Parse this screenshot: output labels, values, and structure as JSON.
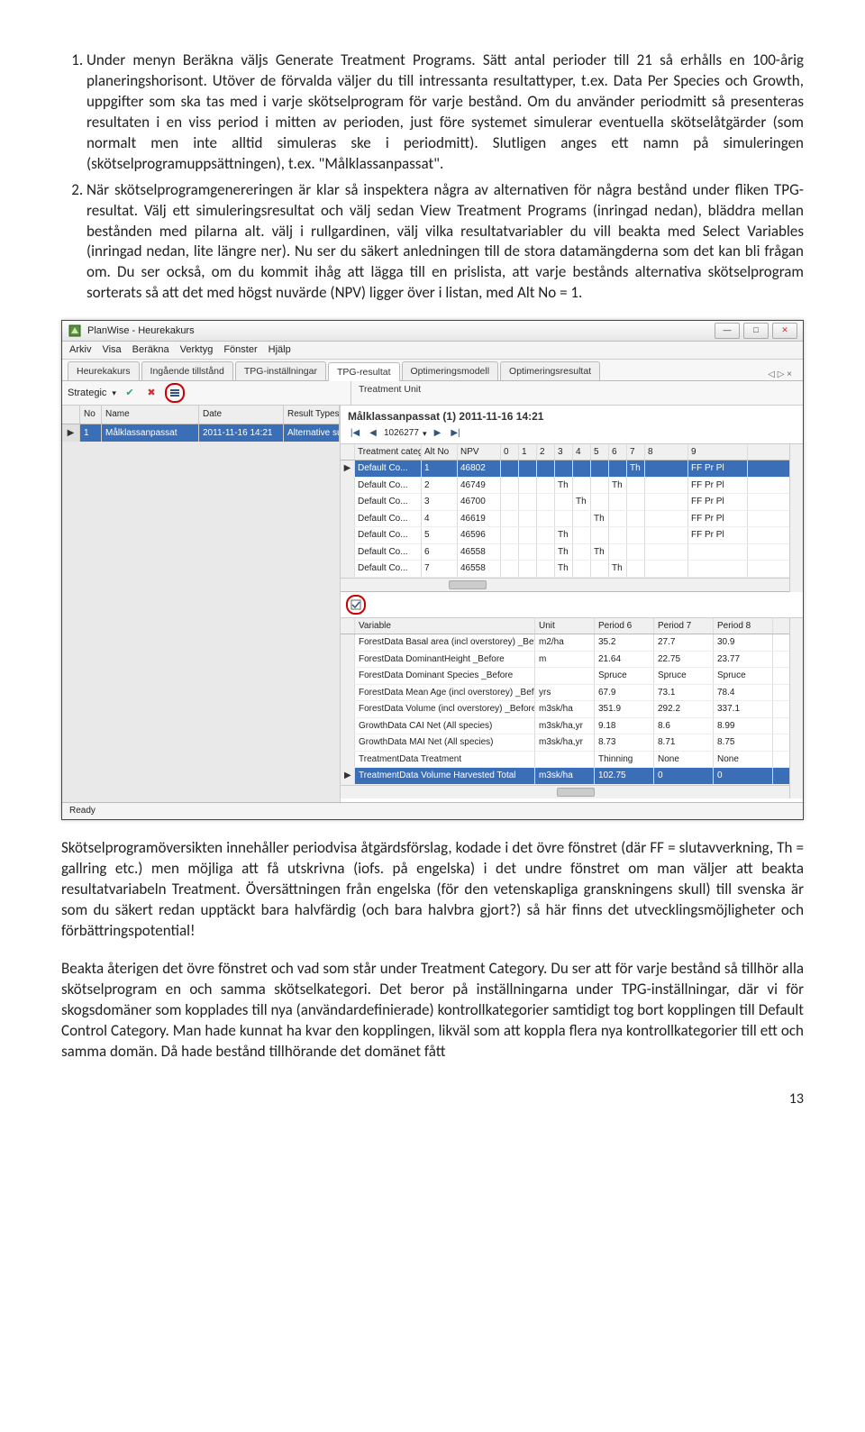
{
  "list": {
    "item1": "Under menyn Beräkna väljs Generate Treatment Programs. Sätt antal perioder till 21 så erhålls en 100-årig planeringshorisont. Utöver de förvalda väljer du till intressanta resultattyper, t.ex. Data Per Species och Growth, uppgifter som ska tas med i varje skötselprogram för varje bestånd. Om du använder periodmitt så presenteras resultaten i en viss period i mitten av perioden, just före systemet simulerar eventuella skötselåtgärder (som normalt men inte alltid simuleras ske i periodmitt). Slutligen anges ett namn på simuleringen (skötselprogramuppsättningen), t.ex. \"Målklassanpassat\".",
    "item2": "När skötselprogramgenereringen är klar så inspektera några av alternativen för några bestånd under fliken TPG-resultat. Välj ett simuleringsresultat och välj sedan View Treatment Programs (inringad nedan), bläddra mellan bestånden med pilarna alt. välj i rullgardinen, välj vilka resultatvariabler du vill beakta med Select Variables (inringad nedan, lite längre ner). Nu ser du säkert anledningen till de stora datamängderna som det kan bli frågan om. Du ser också, om du kommit ihåg att lägga till en prislista, att varje bestånds alternativa skötselprogram sorterats så att det med högst nuvärde (NPV) ligger över i listan, med Alt No = 1."
  },
  "para1": "Skötselprogramöversikten innehåller periodvisa åtgärdsförslag, kodade i det övre fönstret (där FF = slutavverkning, Th = gallring etc.) men möjliga att få utskrivna (iofs. på engelska) i det undre fönstret om man väljer att beakta resultatvariabeln Treatment. Översättningen från engelska (för den vetenskapliga granskningens skull) till svenska är som du säkert redan upptäckt bara halvfärdig (och bara halvbra gjort?) så här finns det utvecklingsmöjligheter och förbättringspotential!",
  "para2": "Beakta återigen det övre fönstret och vad som står under Treatment Category. Du ser att för varje bestånd så tillhör alla skötselprogram en och samma skötselkategori. Det beror på inställningarna under TPG-inställningar, där vi för skogsdomäner som kopplades till nya (användardefinierade) kontrollkategorier samtidigt tog bort kopplingen till Default Control Category. Man hade kunnat ha kvar den kopplingen, likväl som att koppla flera nya kontrollkategorier till ett och samma domän. Då hade bestånd tillhörande det domänet fått",
  "page_number": "13",
  "app": {
    "title": "PlanWise - Heurekakurs",
    "menus": [
      "Arkiv",
      "Visa",
      "Beräkna",
      "Verktyg",
      "Fönster",
      "Hjälp"
    ],
    "tabs": [
      "Heurekakurs",
      "Ingående tillstånd",
      "TPG-inställningar",
      "TPG-resultat",
      "Optimeringsmodell",
      "Optimeringsresultat"
    ],
    "tab_right_nav": "◁ ▷ ×",
    "toolbar_left_label": "Strategic",
    "treatment_unit_label": "Treatment Unit",
    "runs_header": [
      "",
      "No",
      "Name",
      "Date",
      "Result Types"
    ],
    "runs_row": [
      "▶",
      "1",
      "Målklassanpassat",
      "2011-11-16 14:21",
      "Alternative su..."
    ],
    "run_title": "Målklassanpassat (1) 2011-11-16 14:21",
    "record_nav": {
      "first": "|◀",
      "prev": "◀",
      "id": "1026277",
      "next": "▶",
      "last": "▶|",
      "dropdown": "▾"
    },
    "topgrid": {
      "header": [
        "",
        "Treatment category",
        "Alt No",
        "NPV",
        "0",
        "1",
        "2",
        "3",
        "4",
        "5",
        "6",
        "7",
        "8",
        "9"
      ],
      "rows": [
        [
          "▶",
          "Default Co...",
          "1",
          "46802",
          "",
          "",
          "",
          "",
          "",
          "",
          "",
          "Th",
          "",
          "FF Pr Pl"
        ],
        [
          "",
          "Default Co...",
          "2",
          "46749",
          "",
          "",
          "",
          "Th",
          "",
          "",
          "Th",
          "",
          "",
          "FF Pr Pl"
        ],
        [
          "",
          "Default Co...",
          "3",
          "46700",
          "",
          "",
          "",
          "",
          "Th",
          "",
          "",
          "",
          "",
          "FF Pr Pl"
        ],
        [
          "",
          "Default Co...",
          "4",
          "46619",
          "",
          "",
          "",
          "",
          "",
          "Th",
          "",
          "",
          "",
          "FF Pr Pl"
        ],
        [
          "",
          "Default Co...",
          "5",
          "46596",
          "",
          "",
          "",
          "Th",
          "",
          "",
          "",
          "",
          "",
          "FF Pr Pl"
        ],
        [
          "",
          "Default Co...",
          "6",
          "46558",
          "",
          "",
          "",
          "Th",
          "",
          "Th",
          "",
          "",
          "",
          ""
        ],
        [
          "",
          "Default Co...",
          "7",
          "46558",
          "",
          "",
          "",
          "Th",
          "",
          "",
          "Th",
          "",
          "",
          ""
        ]
      ]
    },
    "botgrid": {
      "header": [
        "",
        "Variable",
        "Unit",
        "Period 6",
        "Period 7",
        "Period 8"
      ],
      "rows": [
        [
          "",
          "ForestData Basal area (incl overstorey) _Before",
          "m2/ha",
          "35.2",
          "27.7",
          "30.9"
        ],
        [
          "",
          "ForestData DominantHeight _Before",
          "m",
          "21.64",
          "22.75",
          "23.77"
        ],
        [
          "",
          "ForestData Dominant Species _Before",
          "",
          "Spruce",
          "Spruce",
          "Spruce"
        ],
        [
          "",
          "ForestData Mean Age (incl overstorey) _Before",
          "yrs",
          "67.9",
          "73.1",
          "78.4"
        ],
        [
          "",
          "ForestData Volume (incl overstorey) _Before",
          "m3sk/ha",
          "351.9",
          "292.2",
          "337.1"
        ],
        [
          "",
          "GrowthData CAI Net (All species)",
          "m3sk/ha,yr",
          "9.18",
          "8.6",
          "8.99"
        ],
        [
          "",
          "GrowthData MAI Net (All species)",
          "m3sk/ha,yr",
          "8.73",
          "8.71",
          "8.75"
        ],
        [
          "",
          "TreatmentData Treatment",
          "",
          "Thinning",
          "None",
          "None"
        ],
        [
          "▶",
          "TreatmentData Volume Harvested Total",
          "m3sk/ha",
          "102.75",
          "0",
          "0"
        ]
      ]
    },
    "status": "Ready"
  }
}
